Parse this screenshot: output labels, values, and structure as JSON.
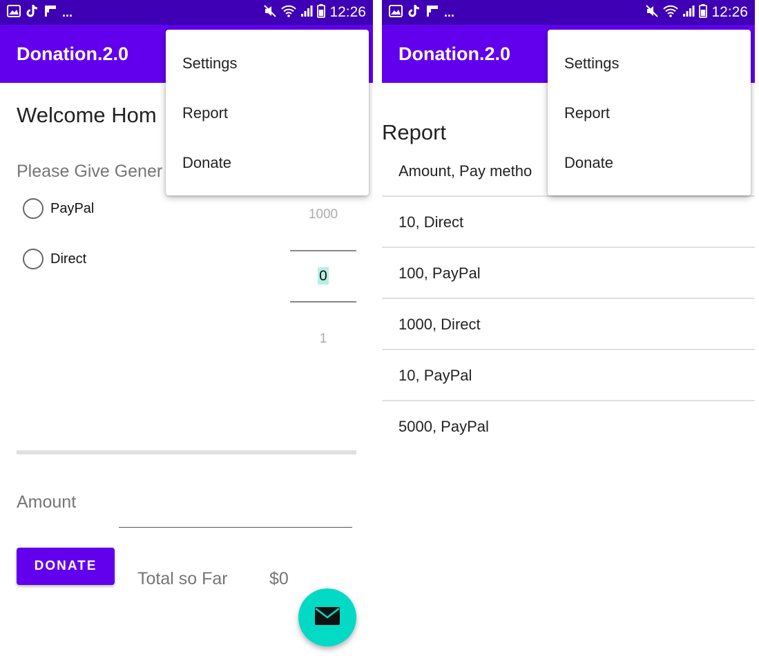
{
  "status_bar": {
    "time": "12:26",
    "overflow": "...",
    "left_icons": [
      "image-icon",
      "tiktok-icon",
      "flipboard-icon"
    ],
    "right_icons": [
      "mute-icon",
      "wifi-icon",
      "signal-icon",
      "battery-icon"
    ]
  },
  "app": {
    "title": "Donation.2.0",
    "primary_color": "#6200ee",
    "status_bar_color": "#3f00b5",
    "accent_color": "#03dac5"
  },
  "menu": {
    "items": [
      "Settings",
      "Report",
      "Donate"
    ]
  },
  "donate_screen": {
    "welcome": "Welcome Hom",
    "subtitle": "Please Give Gener",
    "payment_options": [
      "PayPal",
      "Direct"
    ],
    "selected_payment": null,
    "picker": {
      "above": "1000",
      "selected": "0",
      "below": "1"
    },
    "progress": 0,
    "amount_label": "Amount",
    "amount_value": "",
    "donate_button": "DONATE",
    "total_label": "Total so Far",
    "total_value": "$0",
    "fab_icon": "mail-icon"
  },
  "report_screen": {
    "title": "Report",
    "rows": [
      "Amount, Pay metho",
      "10, Direct",
      "100, PayPal",
      "1000, Direct",
      "10, PayPal",
      "5000, PayPal"
    ]
  }
}
